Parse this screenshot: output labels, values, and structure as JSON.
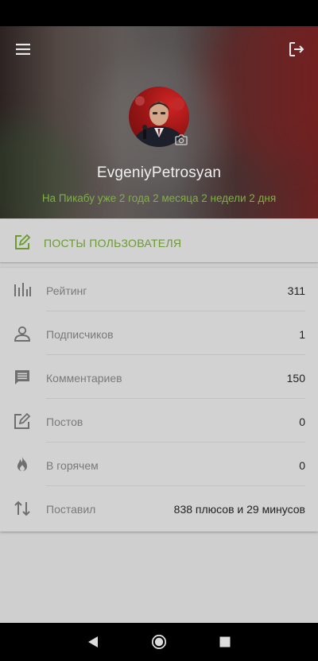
{
  "profile": {
    "username": "EvgeniyPetrosyan",
    "since": "На Пикабу уже 2 года 2 месяца 2 недели 2 дня"
  },
  "posts_button": {
    "label": "ПОСТЫ ПОЛЬЗОВАТЕЛЯ"
  },
  "stats": [
    {
      "label": "Рейтинг",
      "value": "311",
      "icon": "bar-chart-icon"
    },
    {
      "label": "Подписчиков",
      "value": "1",
      "icon": "person-icon"
    },
    {
      "label": "Комментариев",
      "value": "150",
      "icon": "comment-icon"
    },
    {
      "label": "Постов",
      "value": "0",
      "icon": "edit-icon"
    },
    {
      "label": "В горячем",
      "value": "0",
      "icon": "flame-icon"
    },
    {
      "label": "Поставил",
      "value": "838 плюсов и 29 минусов",
      "icon": "swap-vertical-icon"
    }
  ],
  "colors": {
    "accent": "#6c9a33",
    "since_text": "#7fb043",
    "panel_bg": "#d2d2d2"
  }
}
